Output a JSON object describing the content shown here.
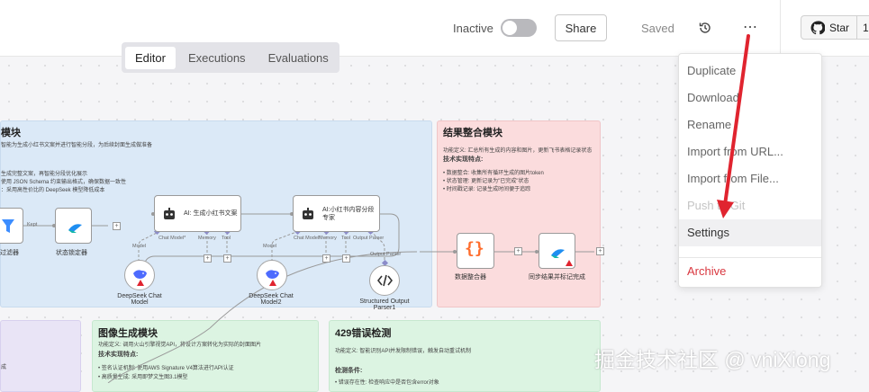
{
  "header": {
    "active_toggle_label": "Inactive",
    "share_label": "Share",
    "save_status": "Saved",
    "star_label": "Star",
    "star_count": "1"
  },
  "tabs": [
    "Editor",
    "Executions",
    "Evaluations"
  ],
  "menu": {
    "items": [
      "Duplicate",
      "Download",
      "Rename",
      "Import from URL...",
      "Import from File...",
      "Push to Git",
      "Settings"
    ],
    "danger_item": "Archive"
  },
  "notes": {
    "blue": {
      "title": "模块",
      "lines": [
        "智能为生成小红书文案并进行智能分段，为后续封面生成做准备",
        "生成完整文案，再智能分段优化展示",
        "使用 JSON Schema 约束输出格式，确保数据一致性",
        "：采用高性价比的 DeepSeek 模型降低成本"
      ]
    },
    "red": {
      "title": "结果整合模块",
      "intro": "功能定义: 汇总所有生成的内容和图片，更新飞书表格记录状态",
      "feature_title": "技术实现特点:",
      "features": [
        "数据整合: 收集所有循环生成的图片token",
        "状态管理: 更新记录为\"已完成\"状态",
        "时间戳记录: 记录生成时间便于追踪"
      ]
    },
    "purple": {
      "lines": [
        "成"
      ]
    },
    "green1": {
      "title": "图像生成模块",
      "intro": "功能定义: 调用火山引擎视觉API，将设计方案转化为实际的封面图片",
      "feature_title": "技术实现特点:",
      "features": [
        "签名认证机制: 使用AWS Signature V4算法进行API认证",
        "高质量生成: 采用即梦文生图3.1模型"
      ]
    },
    "green2": {
      "title": "429错误检测",
      "intro": "功能定义: 智能识别API并发限制错误，触发自动重试机制",
      "feature_title": "检测条件:",
      "features": [
        "错误存在性: 检查响应中是否包含error对象"
      ]
    }
  },
  "nodes": {
    "filter_label": "过滤器",
    "filter_output": "Kept",
    "status_label": "状态锁定器",
    "agent1_name": "AI: 生成小红书文案",
    "agent2_name": "AI:小红书内容分段专家",
    "port_chat_model": "Chat Model*",
    "port_memory": "Memory",
    "port_tool": "Tool",
    "port_output_parser": "Output Parser",
    "model_label": "Model",
    "deepseek1_label": "DeepSeek Chat Model",
    "deepseek2_label": "DeepSeek Chat Model2",
    "parser_label": "Structured Output Parser1",
    "parser_port": "Output Parser",
    "merge_label": "数据整合器",
    "sync_label": "同步结果并标记完成"
  },
  "watermark": "掘金技术社区 @ vniXiong",
  "colors": {
    "danger": "#d9373f",
    "arrow": "#e0242f",
    "note_blue": "#dbe9f7",
    "note_red": "#fbdcdd",
    "note_green": "#dcf4e2",
    "note_purple": "#e9e4f6",
    "merge_icon": "#ff6d2d",
    "filter_icon": "#3c8dff"
  },
  "icons": [
    "history-icon",
    "more-icon",
    "github-icon",
    "robot-icon",
    "filter-icon",
    "deepseek-whale-icon",
    "warning-icon",
    "code-icon",
    "braces-icon",
    "lark-icon"
  ]
}
